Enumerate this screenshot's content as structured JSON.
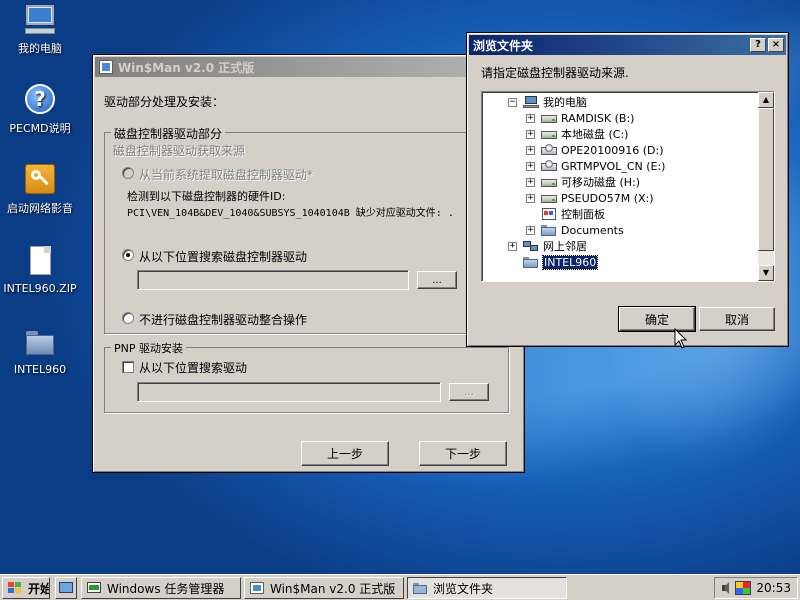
{
  "desktop": {
    "icons": [
      {
        "label": "我的电脑",
        "icon": "computer-icon"
      },
      {
        "label": "PECMD说明",
        "icon": "help-icon"
      },
      {
        "label": "启动网络影音",
        "icon": "key-icon"
      },
      {
        "label": "INTEL960.ZIP",
        "icon": "file-icon"
      },
      {
        "label": "INTEL960",
        "icon": "folder-icon"
      }
    ]
  },
  "winsman": {
    "title": "Win$Man v2.0 正式版",
    "section_heading": "驱动部分处理及安装：",
    "disk_group": {
      "title": "磁盘控制器驱动部分",
      "source_label": "磁盘控制器驱动获取来源",
      "option_system": "从当前系统提取磁盘控制器驱动*",
      "detected_text": "检测到以下磁盘控制器的硬件ID:",
      "hardware_id": "PCI\\VEN_104B&DEV_1040&SUBSYS_1040104B 缺少对应驱动文件: .",
      "option_search": "从以下位置搜索磁盘控制器驱动",
      "path_value": "",
      "browse_label": "...",
      "option_skip": "不进行磁盘控制器驱动整合操作"
    },
    "pnp_group": {
      "title": "PNP 驱动安装",
      "checkbox_label": "从以下位置搜索驱动",
      "path_value": "",
      "browse_label": "..."
    },
    "prev_label": "上一步",
    "next_label": "下一步"
  },
  "browse": {
    "title": "浏览文件夹",
    "help_label": "?",
    "close_label": "×",
    "prompt": "请指定磁盘控制器驱动来源.",
    "tree": [
      {
        "label": "我的电脑",
        "icon": "computer-icon",
        "expander": "−",
        "level": 0
      },
      {
        "label": "RAMDISK (B:)",
        "icon": "drive-icon",
        "expander": "+",
        "level": 1
      },
      {
        "label": "本地磁盘 (C:)",
        "icon": "drive-icon",
        "expander": "+",
        "level": 1
      },
      {
        "label": "OPE20100916 (D:)",
        "icon": "cdrom-icon",
        "expander": "+",
        "level": 1
      },
      {
        "label": "GRTMPVOL_CN (E:)",
        "icon": "cdrom-icon",
        "expander": "+",
        "level": 1
      },
      {
        "label": "可移动磁盘 (H:)",
        "icon": "drive-icon",
        "expander": "+",
        "level": 1
      },
      {
        "label": "PSEUDO57M (X:)",
        "icon": "drive-icon",
        "expander": "+",
        "level": 1
      },
      {
        "label": "控制面板",
        "icon": "control-panel-icon",
        "expander": "",
        "level": 1
      },
      {
        "label": "Documents",
        "icon": "folder-icon",
        "expander": "+",
        "level": 1
      },
      {
        "label": "网上邻居",
        "icon": "network-icon",
        "expander": "+",
        "level": 0
      },
      {
        "label": "INTEL960",
        "icon": "folder-icon",
        "expander": "",
        "level": 0,
        "selected": true
      }
    ],
    "ok_label": "确定",
    "cancel_label": "取消"
  },
  "taskbar": {
    "start_label": "开始",
    "tasks": [
      {
        "label": "Windows 任务管理器",
        "icon": "task-manager-icon"
      },
      {
        "label": "Win$Man v2.0 正式版",
        "icon": "winsman-icon"
      },
      {
        "label": "浏览文件夹",
        "icon": "folder-icon",
        "active": true
      }
    ],
    "clock": "20:53"
  },
  "colors": {
    "title_active": "#0a246a",
    "title_inactive": "#808080",
    "face": "#d4d0c8",
    "selection": "#0a246a"
  }
}
